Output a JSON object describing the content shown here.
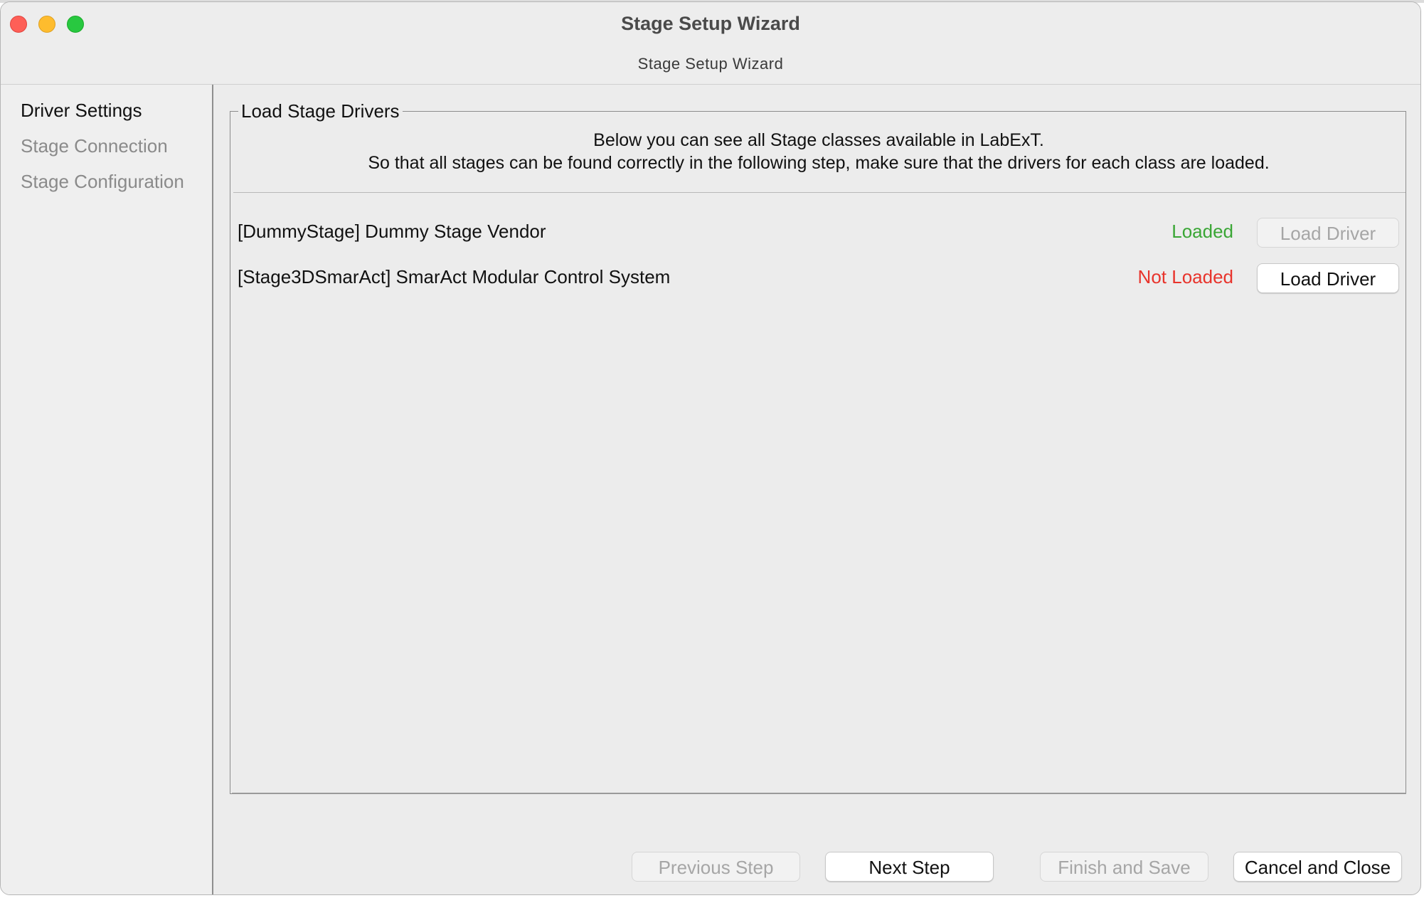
{
  "window": {
    "title": "Stage Setup Wizard",
    "subtitle": "Stage Setup Wizard"
  },
  "sidebar": {
    "items": [
      {
        "label": "Driver Settings",
        "active": true
      },
      {
        "label": "Stage Connection",
        "active": false
      },
      {
        "label": "Stage Configuration",
        "active": false
      }
    ]
  },
  "panel": {
    "title": "Load Stage Drivers",
    "description_line1": "Below you can see all Stage classes available in LabExT.",
    "description_line2": "So that all stages can be found correctly in the following step, make sure that the drivers for each class are loaded.",
    "drivers": [
      {
        "label": "[DummyStage] Dummy Stage Vendor",
        "status": "Loaded",
        "status_color": "#3aa635",
        "button": "Load Driver",
        "button_enabled": false
      },
      {
        "label": "[Stage3DSmarAct] SmarAct Modular Control System",
        "status": "Not Loaded",
        "status_color": "#e8342c",
        "button": "Load Driver",
        "button_enabled": true
      }
    ]
  },
  "footer": {
    "previous": "Previous Step",
    "next": "Next Step",
    "finish": "Finish and Save",
    "cancel": "Cancel and Close"
  },
  "colors": {
    "status_loaded": "#3aa635",
    "status_not_loaded": "#e8342c"
  }
}
